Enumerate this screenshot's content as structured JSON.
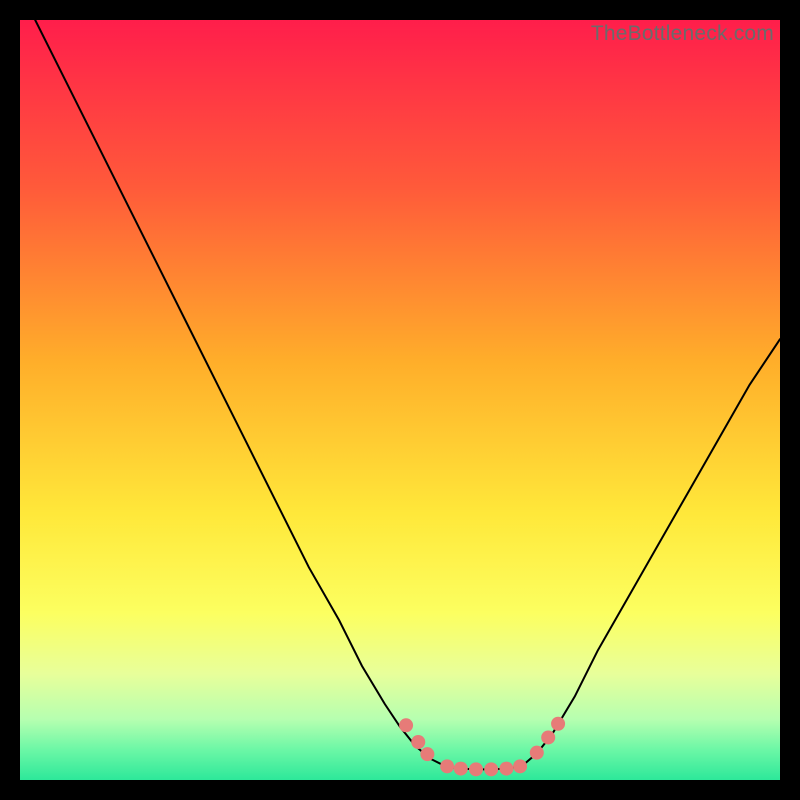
{
  "watermark": "TheBottleneck.com",
  "chart_data": {
    "type": "line",
    "title": "",
    "xlabel": "",
    "ylabel": "",
    "xlim": [
      0,
      100
    ],
    "ylim": [
      0,
      100
    ],
    "gradient_stops": [
      {
        "offset": 0,
        "color": "#ff1e4b"
      },
      {
        "offset": 22,
        "color": "#ff5a3a"
      },
      {
        "offset": 45,
        "color": "#ffae2a"
      },
      {
        "offset": 65,
        "color": "#ffe83a"
      },
      {
        "offset": 78,
        "color": "#fcff60"
      },
      {
        "offset": 86,
        "color": "#e8ff9a"
      },
      {
        "offset": 92,
        "color": "#b6ffb0"
      },
      {
        "offset": 96,
        "color": "#6cf7a6"
      },
      {
        "offset": 100,
        "color": "#2de89a"
      }
    ],
    "series": [
      {
        "name": "left-curve",
        "color": "#000000",
        "stroke_width": 2,
        "x": [
          2,
          6,
          10,
          14,
          18,
          22,
          26,
          30,
          34,
          38,
          42,
          45,
          48,
          50,
          52,
          54,
          56
        ],
        "y": [
          100,
          92,
          84,
          76,
          68,
          60,
          52,
          44,
          36,
          28,
          21,
          15,
          10,
          7,
          4.5,
          2.8,
          1.8
        ]
      },
      {
        "name": "right-curve",
        "color": "#000000",
        "stroke_width": 2,
        "x": [
          66,
          68,
          70,
          73,
          76,
          80,
          84,
          88,
          92,
          96,
          100
        ],
        "y": [
          1.8,
          3.5,
          6,
          11,
          17,
          24,
          31,
          38,
          45,
          52,
          58
        ]
      },
      {
        "name": "valley-floor",
        "color": "#000000",
        "stroke_width": 2,
        "x": [
          56,
          58,
          60,
          62,
          64,
          66
        ],
        "y": [
          1.8,
          1.5,
          1.4,
          1.4,
          1.5,
          1.8
        ]
      }
    ],
    "markers": {
      "color": "#e77b78",
      "radius": 7,
      "points": [
        {
          "x": 50.8,
          "y": 7.2
        },
        {
          "x": 52.4,
          "y": 5.0
        },
        {
          "x": 53.6,
          "y": 3.4
        },
        {
          "x": 56.2,
          "y": 1.8
        },
        {
          "x": 58.0,
          "y": 1.5
        },
        {
          "x": 60.0,
          "y": 1.4
        },
        {
          "x": 62.0,
          "y": 1.4
        },
        {
          "x": 64.0,
          "y": 1.5
        },
        {
          "x": 65.8,
          "y": 1.8
        },
        {
          "x": 68.0,
          "y": 3.6
        },
        {
          "x": 69.5,
          "y": 5.6
        },
        {
          "x": 70.8,
          "y": 7.4
        }
      ]
    }
  }
}
